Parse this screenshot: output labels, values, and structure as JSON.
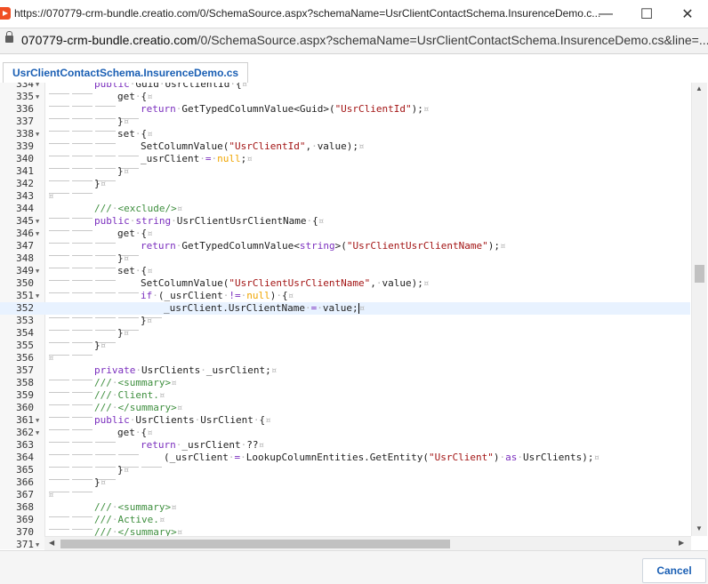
{
  "window": {
    "title": "https://070779-crm-bundle.creatio.com/0/SchemaSource.aspx?schemaName=UsrClientContactSchema.InsurenceDemo.c...",
    "minimize_glyph": "—",
    "maximize_glyph": "☐",
    "close_glyph": "✕"
  },
  "address": {
    "host": "070779-crm-bundle.creatio.com",
    "path": "/0/SchemaSource.aspx?schemaName=UsrClientContactSchema.InsurenceDemo.cs&line=..."
  },
  "tab": {
    "label": "UsrClientContactSchema.InsurenceDemo.cs"
  },
  "editor": {
    "active_line": 352,
    "lines": [
      {
        "n": "334",
        "fold": true,
        "indent": 2,
        "html": "<span class=\"kw\">public</span><span class=\"ws\">·</span>Guid<span class=\"ws\">·</span>UsrClientId<span class=\"ws\">·</span>{<span class=\"pilcrow\">¤</span>"
      },
      {
        "n": "335",
        "fold": true,
        "indent": 3,
        "html": "get<span class=\"ws\">·</span>{<span class=\"pilcrow\">¤</span>"
      },
      {
        "n": "336",
        "fold": false,
        "indent": 4,
        "html": "<span class=\"kw\">return</span><span class=\"ws\">·</span>GetTypedColumnValue&lt;Guid&gt;(<span class=\"str\">\"UsrClientId\"</span>);<span class=\"pilcrow\">¤</span>"
      },
      {
        "n": "337",
        "fold": false,
        "indent": 3,
        "html": "}<span class=\"pilcrow\">¤</span>"
      },
      {
        "n": "338",
        "fold": true,
        "indent": 3,
        "html": "set<span class=\"ws\">·</span>{<span class=\"pilcrow\">¤</span>"
      },
      {
        "n": "339",
        "fold": false,
        "indent": 4,
        "html": "SetColumnValue(<span class=\"str\">\"UsrClientId\"</span>,<span class=\"ws\">·</span>value);<span class=\"pilcrow\">¤</span>"
      },
      {
        "n": "340",
        "fold": false,
        "indent": 4,
        "html": "_usrClient<span class=\"ws\">·</span><span class=\"kw\">=</span><span class=\"ws\">·</span><span class=\"nl\">null</span>;<span class=\"pilcrow\">¤</span>"
      },
      {
        "n": "341",
        "fold": false,
        "indent": 3,
        "html": "}<span class=\"pilcrow\">¤</span>"
      },
      {
        "n": "342",
        "fold": false,
        "indent": 2,
        "html": "}<span class=\"pilcrow\">¤</span>"
      },
      {
        "n": "343",
        "fold": false,
        "indent": 0,
        "html": "<span class=\"pilcrow\">¤</span>"
      },
      {
        "n": "344",
        "fold": false,
        "indent": 2,
        "html": "<span class=\"cm\">///<span class=\"ws\">·</span>&lt;exclude/&gt;</span><span class=\"pilcrow\">¤</span>"
      },
      {
        "n": "345",
        "fold": true,
        "indent": 2,
        "html": "<span class=\"kw\">public</span><span class=\"ws\">·</span><span class=\"kw\">string</span><span class=\"ws\">·</span>UsrClientUsrClientName<span class=\"ws\">·</span>{<span class=\"pilcrow\">¤</span>"
      },
      {
        "n": "346",
        "fold": true,
        "indent": 3,
        "html": "get<span class=\"ws\">·</span>{<span class=\"pilcrow\">¤</span>"
      },
      {
        "n": "347",
        "fold": false,
        "indent": 4,
        "html": "<span class=\"kw\">return</span><span class=\"ws\">·</span>GetTypedColumnValue&lt;<span class=\"kw\">string</span>&gt;(<span class=\"str\">\"UsrClientUsrClientName\"</span>);<span class=\"pilcrow\">¤</span>"
      },
      {
        "n": "348",
        "fold": false,
        "indent": 3,
        "html": "}<span class=\"pilcrow\">¤</span>"
      },
      {
        "n": "349",
        "fold": true,
        "indent": 3,
        "html": "set<span class=\"ws\">·</span>{<span class=\"pilcrow\">¤</span>"
      },
      {
        "n": "350",
        "fold": false,
        "indent": 4,
        "html": "SetColumnValue(<span class=\"str\">\"UsrClientUsrClientName\"</span>,<span class=\"ws\">·</span>value);<span class=\"pilcrow\">¤</span>"
      },
      {
        "n": "351",
        "fold": true,
        "indent": 4,
        "html": "<span class=\"kw\">if</span><span class=\"ws\">·</span>(_usrClient<span class=\"ws\">·</span><span class=\"kw\">!=</span><span class=\"ws\">·</span><span class=\"nl\">null</span>)<span class=\"ws\">·</span>{<span class=\"pilcrow\">¤</span>"
      },
      {
        "n": "352",
        "fold": false,
        "indent": 5,
        "html": "_usrClient.UsrClientName<span class=\"ws\">·</span><span class=\"kw\">=</span><span class=\"ws\">·</span>value;<span class=\"cursor\"></span><span class=\"pilcrow\">¤</span>"
      },
      {
        "n": "353",
        "fold": false,
        "indent": 4,
        "html": "}<span class=\"pilcrow\">¤</span>"
      },
      {
        "n": "354",
        "fold": false,
        "indent": 3,
        "html": "}<span class=\"pilcrow\">¤</span>"
      },
      {
        "n": "355",
        "fold": false,
        "indent": 2,
        "html": "}<span class=\"pilcrow\">¤</span>"
      },
      {
        "n": "356",
        "fold": false,
        "indent": 0,
        "html": "<span class=\"pilcrow\">¤</span>"
      },
      {
        "n": "357",
        "fold": false,
        "indent": 2,
        "html": "<span class=\"kw\">private</span><span class=\"ws\">·</span>UsrClients<span class=\"ws\">·</span>_usrClient;<span class=\"pilcrow\">¤</span>"
      },
      {
        "n": "358",
        "fold": false,
        "indent": 2,
        "html": "<span class=\"cm\">///<span class=\"ws\">·</span>&lt;summary&gt;</span><span class=\"pilcrow\">¤</span>"
      },
      {
        "n": "359",
        "fold": false,
        "indent": 2,
        "html": "<span class=\"cm\">///<span class=\"ws\">·</span>Client.</span><span class=\"pilcrow\">¤</span>"
      },
      {
        "n": "360",
        "fold": false,
        "indent": 2,
        "html": "<span class=\"cm\">///<span class=\"ws\">·</span>&lt;/summary&gt;</span><span class=\"pilcrow\">¤</span>"
      },
      {
        "n": "361",
        "fold": true,
        "indent": 2,
        "html": "<span class=\"kw\">public</span><span class=\"ws\">·</span>UsrClients<span class=\"ws\">·</span>UsrClient<span class=\"ws\">·</span>{<span class=\"pilcrow\">¤</span>"
      },
      {
        "n": "362",
        "fold": true,
        "indent": 3,
        "html": "get<span class=\"ws\">·</span>{<span class=\"pilcrow\">¤</span>"
      },
      {
        "n": "363",
        "fold": false,
        "indent": 4,
        "html": "<span class=\"kw\">return</span><span class=\"ws\">·</span>_usrClient<span class=\"ws\">·</span>??<span class=\"pilcrow\">¤</span>"
      },
      {
        "n": "364",
        "fold": false,
        "indent": 5,
        "html": "(_usrClient<span class=\"ws\">·</span><span class=\"kw\">=</span><span class=\"ws\">·</span>LookupColumnEntities.GetEntity(<span class=\"str\">\"UsrClient\"</span>)<span class=\"ws\">·</span><span class=\"kw\">as</span><span class=\"ws\">·</span>UsrClients);<span class=\"pilcrow\">¤</span>"
      },
      {
        "n": "365",
        "fold": false,
        "indent": 3,
        "html": "}<span class=\"pilcrow\">¤</span>"
      },
      {
        "n": "366",
        "fold": false,
        "indent": 2,
        "html": "}<span class=\"pilcrow\">¤</span>"
      },
      {
        "n": "367",
        "fold": false,
        "indent": 0,
        "html": "<span class=\"pilcrow\">¤</span>"
      },
      {
        "n": "368",
        "fold": false,
        "indent": 2,
        "html": "<span class=\"cm\">///<span class=\"ws\">·</span>&lt;summary&gt;</span><span class=\"pilcrow\">¤</span>"
      },
      {
        "n": "369",
        "fold": false,
        "indent": 2,
        "html": "<span class=\"cm\">///<span class=\"ws\">·</span>Active.</span><span class=\"pilcrow\">¤</span>"
      },
      {
        "n": "370",
        "fold": false,
        "indent": 2,
        "html": "<span class=\"cm\">///<span class=\"ws\">·</span>&lt;/summary&gt;</span><span class=\"pilcrow\">¤</span>"
      },
      {
        "n": "371",
        "fold": true,
        "indent": 0,
        "html": ""
      }
    ]
  },
  "footer": {
    "cancel_label": "Cancel"
  },
  "colors": {
    "keyword": "#7b2fbe",
    "string": "#a31515",
    "comment": "#3f8f3f",
    "null": "#f0a500",
    "accent": "#1a5fb4"
  },
  "icons": {
    "lock": "lock-icon",
    "app": "creatio-app-icon"
  }
}
